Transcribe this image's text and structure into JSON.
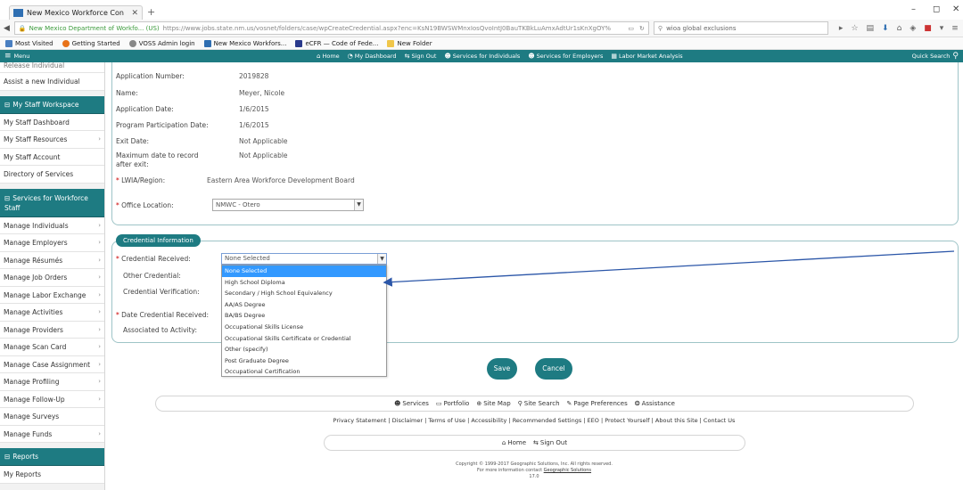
{
  "browser": {
    "tab_title": "New Mexico Workforce Con",
    "tab_close": "✕",
    "new_tab": "+",
    "org": "New Mexico Department of Workfo... (US)",
    "url": "https://www.jobs.state.nm.us/vosnet/folders/case/wpCreateCredential.aspx?enc=KsN19BWSWMnxIosQvoIntJ0BauTKBkLuAmxAdtUr1sKnXgOY%",
    "search_text": "wioa global exclusions",
    "bookmarks": [
      "Most Visited",
      "Getting Started",
      "VOSS Admin login",
      "New Mexico Workfors...",
      "eCFR — Code of Fede...",
      "New Folder"
    ]
  },
  "sitenav": {
    "menu_label": "Menu",
    "links": [
      {
        "icon": "⌂",
        "label": "Home"
      },
      {
        "icon": "◔",
        "label": "My Dashboard"
      },
      {
        "icon": "⇆",
        "label": "Sign Out"
      },
      {
        "icon": "☻",
        "label": "Services for Individuals"
      },
      {
        "icon": "☻",
        "label": "Services for Employers"
      },
      {
        "icon": "▦",
        "label": "Labor Market Analysis"
      }
    ],
    "quick_search": "Quick Search"
  },
  "sidebar": {
    "cut_item": "Release Individual",
    "item_assist": "Assist a new Individual",
    "staff_header": "My Staff Workspace",
    "staff_items": [
      {
        "label": "My Staff Dashboard",
        "arrow": ""
      },
      {
        "label": "My Staff Resources",
        "arrow": "›"
      },
      {
        "label": "My Staff Account",
        "arrow": ""
      },
      {
        "label": "Directory of Services",
        "arrow": ""
      }
    ],
    "services_header": "Services for Workforce Staff",
    "services_items": [
      {
        "label": "Manage Individuals",
        "arrow": "›"
      },
      {
        "label": "Manage Employers",
        "arrow": "›"
      },
      {
        "label": "Manage Résumés",
        "arrow": "›"
      },
      {
        "label": "Manage Job Orders",
        "arrow": "›"
      },
      {
        "label": "Manage Labor Exchange",
        "arrow": "›"
      },
      {
        "label": "Manage Activities",
        "arrow": "›"
      },
      {
        "label": "Manage Providers",
        "arrow": "›"
      },
      {
        "label": "Manage Scan Card",
        "arrow": "›"
      },
      {
        "label": "Manage Case Assignment",
        "arrow": "›"
      },
      {
        "label": "Manage Profiling",
        "arrow": "›"
      },
      {
        "label": "Manage Follow-Up",
        "arrow": "›"
      },
      {
        "label": "Manage Surveys",
        "arrow": ""
      },
      {
        "label": "Manage Funds",
        "arrow": "›"
      }
    ],
    "reports_header": "Reports",
    "reports_items": [
      {
        "label": "My Reports",
        "arrow": ""
      }
    ]
  },
  "details": [
    {
      "label": "Application Number:",
      "value": "2019828"
    },
    {
      "label": "Name:",
      "value": "Meyer, Nicole"
    },
    {
      "label": "Application Date:",
      "value": "1/6/2015"
    },
    {
      "label": "Program Participation Date:",
      "value": "1/6/2015"
    },
    {
      "label": "Exit Date:",
      "value": "Not Applicable"
    },
    {
      "label": "Maximum date to record after exit:",
      "value": "Not Applicable"
    }
  ],
  "lwia": {
    "label": "LWIA/Region:",
    "value": "Eastern Area Workforce Development Board"
  },
  "office": {
    "label": "Office Location:",
    "value": "NMWC - Otero"
  },
  "credential": {
    "legend": "Credential Information",
    "received_label": "Credential Received:",
    "received_value": "None Selected",
    "other_label": "Other Credential:",
    "verification_label": "Credential Verification:",
    "date_label": "Date Credential Received:",
    "activity_label": "Associated to Activity:",
    "options": [
      "None Selected",
      "High School Diploma",
      "Secondary / High School Equivalency",
      "AA/AS Degree",
      "BA/BS Degree",
      "Occupational Skills License",
      "Occupational Skills Certificate or Credential",
      "Other (specify)",
      "Post Graduate Degree",
      "Occupational Certification"
    ],
    "selected_index": 0
  },
  "buttons": {
    "save": "Save",
    "cancel": "Cancel"
  },
  "footer": {
    "links": [
      {
        "icon": "☻",
        "label": "Services"
      },
      {
        "icon": "▭",
        "label": "Portfolio"
      },
      {
        "icon": "⊕",
        "label": "Site Map"
      },
      {
        "icon": "⚲",
        "label": "Site Search"
      },
      {
        "icon": "✎",
        "label": "Page Preferences"
      },
      {
        "icon": "❂",
        "label": "Assistance"
      }
    ],
    "legal": "Privacy Statement | Disclaimer | Terms of Use | Accessibility | Recommended Settings | EEO | Protect Yourself | About this Site | Contact Us",
    "home": "Home",
    "signout": "Sign Out",
    "copyright": "Copyright © 1999-2017 Geographic Solutions, Inc. All rights reserved.",
    "contact_prefix": "For more information contact",
    "contact_link": "Geographic Solutions",
    "version": "17.0"
  },
  "colors": {
    "teal": "#1e7b82",
    "highlight": "#3399ff",
    "arrow": "#2b56a8"
  }
}
